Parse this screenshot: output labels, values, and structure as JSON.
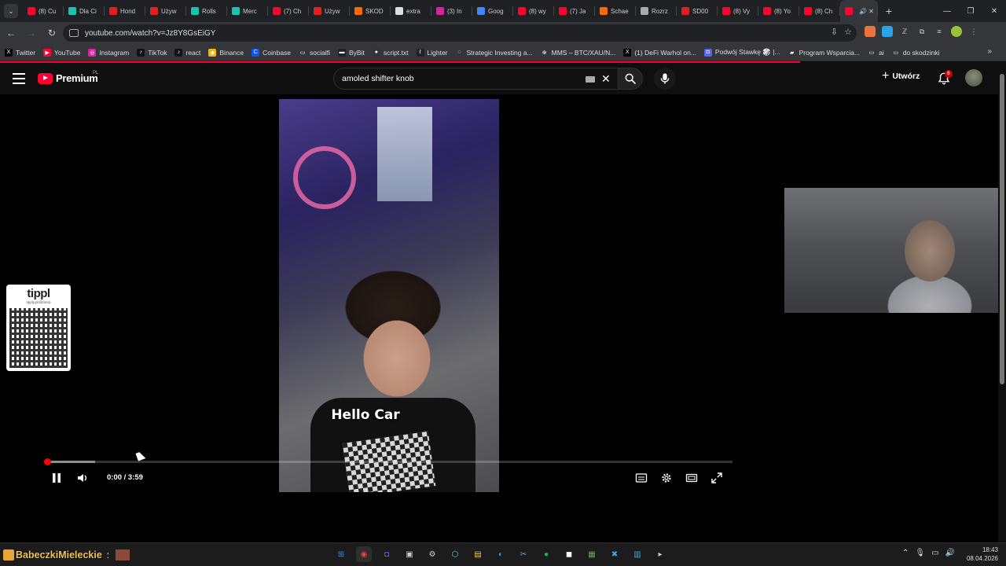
{
  "browser": {
    "tabs": [
      {
        "title": "(8) Cu",
        "color": "#ff0033"
      },
      {
        "title": "Dla Ci",
        "color": "#19c3b0"
      },
      {
        "title": "Hond",
        "color": "#e02020"
      },
      {
        "title": "Używ",
        "color": "#e02020"
      },
      {
        "title": "Rolls",
        "color": "#19c3b0"
      },
      {
        "title": "Merc",
        "color": "#19c3b0"
      },
      {
        "title": "(7) Ch",
        "color": "#ff0033"
      },
      {
        "title": "Używ",
        "color": "#e02020"
      },
      {
        "title": "SKOD",
        "color": "#ff6a00"
      },
      {
        "title": "extra",
        "color": "#dddddd"
      },
      {
        "title": "(3) In",
        "color": "#d6249f"
      },
      {
        "title": "Goog",
        "color": "#4285f4"
      },
      {
        "title": "(8) wy",
        "color": "#ff0033"
      },
      {
        "title": "(7) Ja",
        "color": "#ff0033"
      },
      {
        "title": "Schae",
        "color": "#ff6a00"
      },
      {
        "title": "Rozrz",
        "color": "#aaaaaa"
      },
      {
        "title": "SD00",
        "color": "#e02020"
      },
      {
        "title": "(8) Vy",
        "color": "#ff0033"
      },
      {
        "title": "(8) Yo",
        "color": "#ff0033"
      },
      {
        "title": "(8) Ch",
        "color": "#ff0033"
      },
      {
        "title": "",
        "color": "#ff0033",
        "active": true
      }
    ],
    "url": "youtube.com/watch?v=Jz8Y8GsEiGY",
    "bookmarks": [
      {
        "label": "Twitter",
        "icon": "x-icon",
        "color": "#000000",
        "glyph": "X"
      },
      {
        "label": "YouTube",
        "icon": "youtube-icon",
        "color": "#ff0033",
        "glyph": "▶"
      },
      {
        "label": "Instagram",
        "icon": "instagram-icon",
        "color": "#d6249f",
        "glyph": "◎"
      },
      {
        "label": "TikTok",
        "icon": "tiktok-icon",
        "color": "#111111",
        "glyph": "♪"
      },
      {
        "label": "react",
        "icon": "tiktok-icon",
        "color": "#111111",
        "glyph": "♪"
      },
      {
        "label": "Binance",
        "icon": "binance-icon",
        "color": "#f0b90b",
        "glyph": "◆"
      },
      {
        "label": "Coinbase",
        "icon": "coinbase-icon",
        "color": "#1652f0",
        "glyph": "C"
      },
      {
        "label": "socialfi",
        "icon": "folder-icon",
        "color": "transparent",
        "glyph": "▭"
      },
      {
        "label": "ByBit",
        "icon": "bybit-icon",
        "color": "#222222",
        "glyph": "▬"
      },
      {
        "label": "script.txt",
        "icon": "github-icon",
        "color": "#333333",
        "glyph": "●"
      },
      {
        "label": "Lighter",
        "icon": "lighter-icon",
        "color": "#222222",
        "glyph": "ℓ"
      },
      {
        "label": "Strategic Investing a...",
        "icon": "loading-icon",
        "color": "transparent",
        "glyph": "◌"
      },
      {
        "label": "MMS – BTC/XAU/N...",
        "icon": "globe-icon",
        "color": "transparent",
        "glyph": "⊕"
      },
      {
        "label": "(1) DeFi Warhol on...",
        "icon": "x-icon",
        "color": "#000000",
        "glyph": "X"
      },
      {
        "label": "Podwój Stawkę 🎲 |...",
        "icon": "discord-icon",
        "color": "#5865f2",
        "glyph": "◘"
      },
      {
        "label": "Program Wsparcia...",
        "icon": "flag-icon",
        "color": "transparent",
        "glyph": "▰"
      },
      {
        "label": "ai",
        "icon": "folder-icon",
        "color": "transparent",
        "glyph": "▭"
      },
      {
        "label": "do skodzinki",
        "icon": "folder-icon",
        "color": "transparent",
        "glyph": "▭"
      }
    ]
  },
  "youtube": {
    "logo_text": "Premium",
    "country": "PL",
    "search_query": "amoled shifter knob",
    "create_label": "Utwórz",
    "notification_count": "8"
  },
  "video": {
    "caption": "Hello Car",
    "time_display": "0:00 / 3:59",
    "played_fraction": 0.0,
    "buffered_fraction": 0.07
  },
  "overlay": {
    "qr_brand": "tippl",
    "qr_url": "tipply.pl/@fanrp"
  },
  "taskbar": {
    "ticker_text": "BabeczkiMieleckie",
    "ticker_colon": ":",
    "time": "18:43",
    "date": "08.04.2026",
    "apps": [
      {
        "name": "start-icon",
        "glyph": "⊞",
        "color": "#2f8bea"
      },
      {
        "name": "chrome-icon",
        "glyph": "◉",
        "color": "#e8453c"
      },
      {
        "name": "discord-icon",
        "glyph": "◘",
        "color": "#5865f2"
      },
      {
        "name": "app-icon",
        "glyph": "▣",
        "color": "#cccccc"
      },
      {
        "name": "settings-icon",
        "glyph": "⚙",
        "color": "#cccccc"
      },
      {
        "name": "steam-icon",
        "glyph": "⬡",
        "color": "#66c0f4"
      },
      {
        "name": "folder-icon",
        "glyph": "▤",
        "color": "#f6c342"
      },
      {
        "name": "edge-icon",
        "glyph": "◐",
        "color": "#2b9fd9"
      },
      {
        "name": "tool-icon",
        "glyph": "✂",
        "color": "#4aa3df"
      },
      {
        "name": "spotify-icon",
        "glyph": "●",
        "color": "#1db954"
      },
      {
        "name": "camera-icon",
        "glyph": "◼",
        "color": "#ffffff"
      },
      {
        "name": "minecraft-icon",
        "glyph": "▦",
        "color": "#6fa35a"
      },
      {
        "name": "x-app-icon",
        "glyph": "✖",
        "color": "#4aa3df"
      },
      {
        "name": "notepad-icon",
        "glyph": "▥",
        "color": "#4aa3df"
      },
      {
        "name": "terminal-icon",
        "glyph": "▸",
        "color": "#cccccc"
      }
    ]
  }
}
